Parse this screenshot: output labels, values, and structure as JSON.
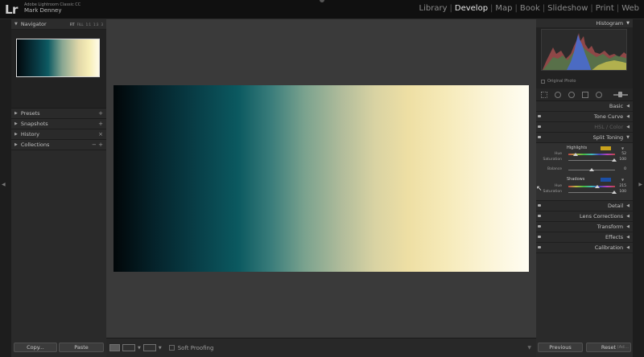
{
  "app": {
    "logo": "Lr",
    "product": "Adobe Lightroom Classic CC",
    "user": "Mark Denney"
  },
  "modules": [
    {
      "label": "Library",
      "active": false
    },
    {
      "label": "Develop",
      "active": true
    },
    {
      "label": "Map",
      "active": false
    },
    {
      "label": "Book",
      "active": false
    },
    {
      "label": "Slideshow",
      "active": false
    },
    {
      "label": "Print",
      "active": false
    },
    {
      "label": "Web",
      "active": false
    }
  ],
  "module_separator": "|",
  "left_panel": {
    "navigator": {
      "title": "Navigator",
      "zoom_options": [
        "FIT",
        "FILL",
        "1:1",
        "1:3",
        "3"
      ],
      "zoom_active": "FIT"
    },
    "sections": [
      {
        "title": "Presets",
        "action": "+"
      },
      {
        "title": "Snapshots",
        "action": "+"
      },
      {
        "title": "History",
        "action": "×"
      },
      {
        "title": "Collections",
        "action": "− +"
      }
    ],
    "buttons": {
      "copy": "Copy...",
      "paste": "Paste"
    }
  },
  "toolbar": {
    "soft_proofing": "Soft Proofing"
  },
  "right_panel": {
    "histogram_title": "Histogram",
    "original_photo": "Original Photo",
    "sections_top": [
      {
        "title": "Basic",
        "dim": false
      },
      {
        "title": "Tone Curve",
        "dim": false
      },
      {
        "title": "HSL / Color",
        "dim": true
      }
    ],
    "split_toning": {
      "title": "Split Toning",
      "highlights_label": "Highlights",
      "highlights_color": "#c9a21c",
      "highlights_hue": "52",
      "highlights_saturation": "100",
      "balance": "0",
      "shadows_label": "Shadows",
      "shadows_color": "#1c4fa6",
      "shadows_hue": "215",
      "shadows_saturation": "100",
      "hue_label": "Hue",
      "saturation_label": "Saturation",
      "balance_label": "Balance"
    },
    "sections_bottom": [
      {
        "title": "Detail"
      },
      {
        "title": "Lens Corrections"
      },
      {
        "title": "Transform"
      },
      {
        "title": "Effects"
      },
      {
        "title": "Calibration"
      }
    ],
    "buttons": {
      "previous": "Previous",
      "reset": "Reset",
      "reset_ghost": "(Ad..."
    }
  },
  "icons": {
    "collapse": "triangle-down-icon",
    "expand": "triangle-right-icon",
    "panel_left": "triangle-left-icon",
    "chip": "triangle-down-icon"
  }
}
